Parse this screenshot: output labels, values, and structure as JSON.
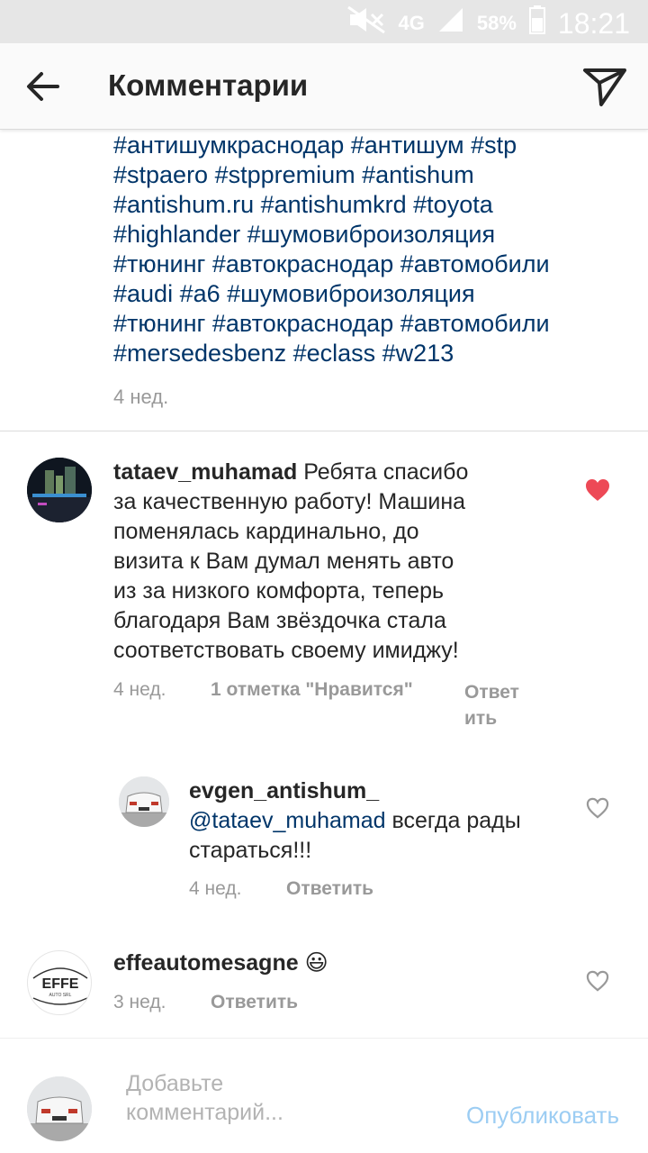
{
  "status_bar": {
    "network": "4G",
    "battery": "58%",
    "time": "18:21"
  },
  "header": {
    "title": "Комментарии"
  },
  "caption": {
    "lines": [
      "#антишумкраснодар #антишум #stp",
      "#stpaero #stppremium #antishum",
      "#antishum.ru #antishumkrd #toyota",
      "#highlander #шумовиброизоляция",
      "#тюнинг #автокраснодар #автомобили",
      "#audi #a6 #шумовиброизоляция",
      "#тюнинг #автокраснодар #автомобили",
      "#mersedesbenz #eclass #w213"
    ],
    "time": "4 нед."
  },
  "comments": [
    {
      "username": "tataev_muhamad",
      "text_lines": [
        "Ребята спасибо",
        "за качественную работу! Машина",
        "поменялась кардинально, до",
        "визита к Вам думал менять авто",
        "из за низкого комфорта, теперь",
        "благодаря Вам звёздочка стала",
        "соответствовать своему имиджу!"
      ],
      "time": "4 нед.",
      "likes": "1 отметка \"Нравится\"",
      "reply_line1": "Ответ",
      "reply_line2": "ить",
      "liked": true
    },
    {
      "username": "evgen_antishum_",
      "mention": "@tataev_muhamad",
      "text_after_mention": "всегда рады",
      "text_line2": "стараться!!!",
      "time": "4 нед.",
      "reply": "Ответить",
      "liked": false
    },
    {
      "username": "effeautomesagne",
      "emoji": "😃",
      "time": "3 нед.",
      "reply": "Ответить",
      "liked": false,
      "avatar_logo": "EFFE",
      "avatar_logo_sub": "AUTO SRL"
    }
  ],
  "comment_input": {
    "placeholder_line1": "Добавьте",
    "placeholder_line2": "комментарий...",
    "publish": "Опубликовать"
  },
  "colors": {
    "hashtag": "#003569",
    "heart_liked": "#ed4956",
    "publish_disabled": "#9ccdf3",
    "secondary_text": "#999999"
  }
}
